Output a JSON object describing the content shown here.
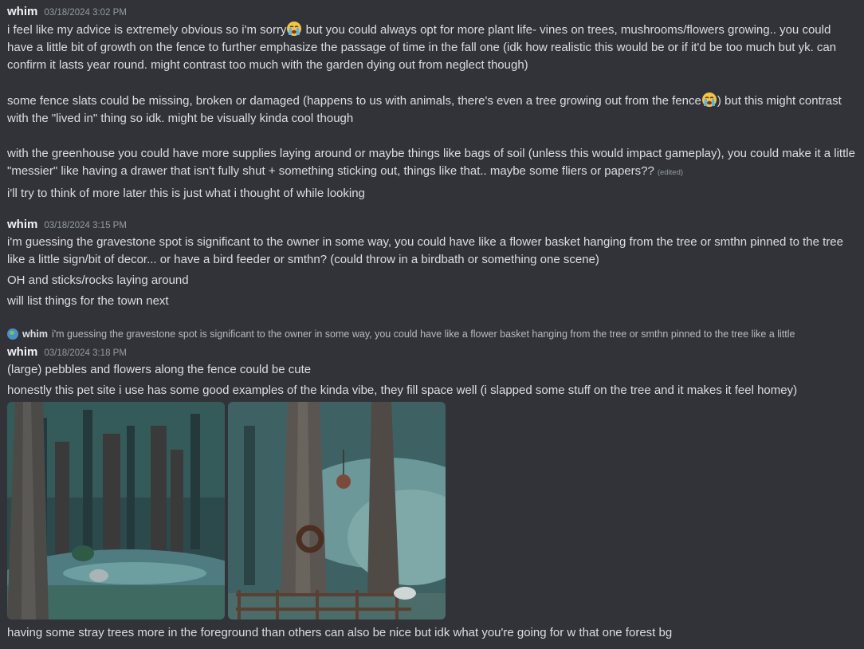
{
  "messages": [
    {
      "author": "whim",
      "timestamp": "03/18/2024 3:02 PM",
      "p1_a": "i feel like my advice is extremely obvious so i'm sorry",
      "p1_b": " but you could always opt for more plant life- vines on trees, mushrooms/flowers growing.. you could have a little bit of growth on the fence to further emphasize the passage of time in the fall one (idk how realistic this would be or if it'd be too much but yk. can confirm it lasts year round. might contrast too much with the garden dying out from neglect though)",
      "p2_a": "some fence slats could be missing, broken or damaged (happens to us with animals, there's even a tree growing out from the fence",
      "p2_b": ") but this might contrast with the \"lived in\" thing so idk. might be visually kinda cool though",
      "p3": "with the greenhouse you could have more supplies laying around or maybe things like bags of soil (unless this would impact gameplay), you could make it a little \"messier\" like having a drawer that isn't fully shut + something sticking out, things like that.. maybe some fliers or papers??",
      "edited": "(edited)",
      "p4": "i'll try to think of more later this is just what i thought of while looking",
      "emoji": "loudly-crying-face-emoji"
    },
    {
      "author": "whim",
      "timestamp": "03/18/2024 3:15 PM",
      "p1": "i'm guessing the gravestone spot is significant to the owner in some way, you could have like a flower basket hanging from the tree or smthn pinned to the tree like a little sign/bit of decor... or have a bird feeder or smthn? (could throw in a birdbath or something one scene)",
      "p2": "OH and sticks/rocks laying around",
      "p3": "will list things for the town next"
    },
    {
      "reply_author": "whim",
      "reply_preview": "i'm guessing the gravestone spot is significant to the owner in some way, you could have like a flower basket hanging from the tree or smthn pinned to the tree like a little",
      "author": "whim",
      "timestamp": "03/18/2024 3:18 PM",
      "p1": "(large) pebbles and flowers along the fence could be cute",
      "p2": "honestly this pet site i use has some good examples of the kinda vibe, they fill space well (i slapped some stuff on the tree and it makes it feel homey)",
      "attachments": [
        "forest-scene-image",
        "tree-with-wreath-scene-image"
      ],
      "p3": "having some stray trees more in the foreground than others can also be nice but idk what you're going for w that one forest bg"
    }
  ],
  "colors": {
    "background": "#313338",
    "text": "#dbdee1",
    "muted": "#949ba4",
    "author": "#f2f3f5"
  }
}
